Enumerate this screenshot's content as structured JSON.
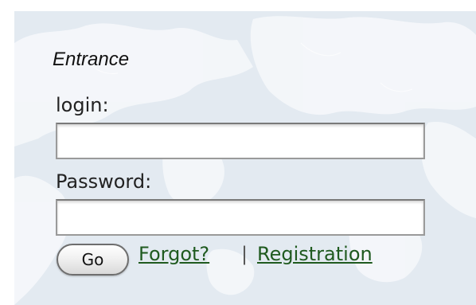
{
  "login_form": {
    "heading": "Entrance",
    "login_label": "login:",
    "login_value": "",
    "password_label": "Password:",
    "password_value": "",
    "go_label": "Go",
    "forgot_label": "Forgot?",
    "separator": "|",
    "registration_label": "Registration"
  },
  "colors": {
    "panel_background": "#e3eaf1",
    "map_land": "#f4f7fa",
    "link": "#1f5a1f"
  }
}
